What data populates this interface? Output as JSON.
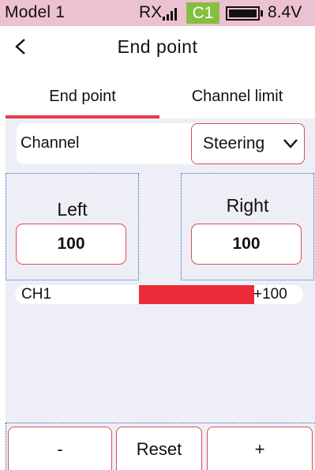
{
  "status_bar": {
    "model": "Model 1",
    "rx_label": "RX",
    "signal_icon": "signal-bars-icon",
    "channel_badge": "C1",
    "badge_color": "#86bf3f",
    "battery_icon": "battery-full-icon",
    "voltage": "8.4V",
    "background": "#ecc1d2"
  },
  "header": {
    "back_icon": "chevron-left-icon",
    "title": "End point"
  },
  "tabs": [
    {
      "label": "End point",
      "active": true
    },
    {
      "label": "Channel limit",
      "active": false
    }
  ],
  "channel": {
    "label": "Channel",
    "selected": "Steering",
    "dropdown_icon": "chevron-down-icon"
  },
  "left": {
    "label": "Left",
    "value": "100"
  },
  "right": {
    "label": "Right",
    "value": "100"
  },
  "channel_output": {
    "name": "CH1",
    "value_text": "+100",
    "bar_fill_fraction": 0.4,
    "bar_color": "#ec2a38"
  },
  "buttons": {
    "minus": "-",
    "reset": "Reset",
    "plus": "+"
  },
  "accent_color": "#e23b47"
}
